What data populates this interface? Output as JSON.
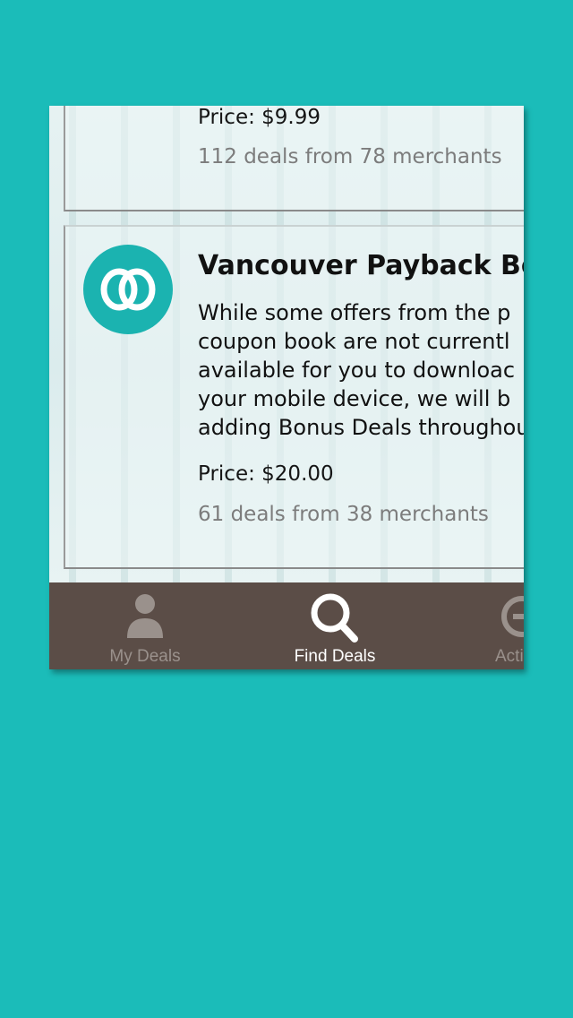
{
  "cards": [
    {
      "price": "Price: $9.99",
      "deals_count": "112 deals from 78 merchants"
    },
    {
      "title": "Vancouver Payback Boo",
      "description_lines": [
        "While some offers from the p",
        "coupon book are not currentl",
        "available for you to downloac",
        "your mobile device, we will b",
        "adding Bonus Deals throughou"
      ],
      "price": "Price: $20.00",
      "deals_count": "61 deals from 38 merchants",
      "logo_icon": "linked-rings-icon"
    }
  ],
  "tab_bar": {
    "tabs": [
      {
        "label": "My Deals",
        "icon": "person-icon",
        "active": false
      },
      {
        "label": "Find Deals",
        "icon": "search-icon",
        "active": true
      },
      {
        "label": "Acti",
        "icon": "activity-icon",
        "active": false
      }
    ]
  },
  "colors": {
    "background": "#1bbcb9",
    "tab_bar": "#5b4d47",
    "logo": "#1bb3b0",
    "tab_active": "#ffffff",
    "tab_inactive": "#9a918c"
  }
}
